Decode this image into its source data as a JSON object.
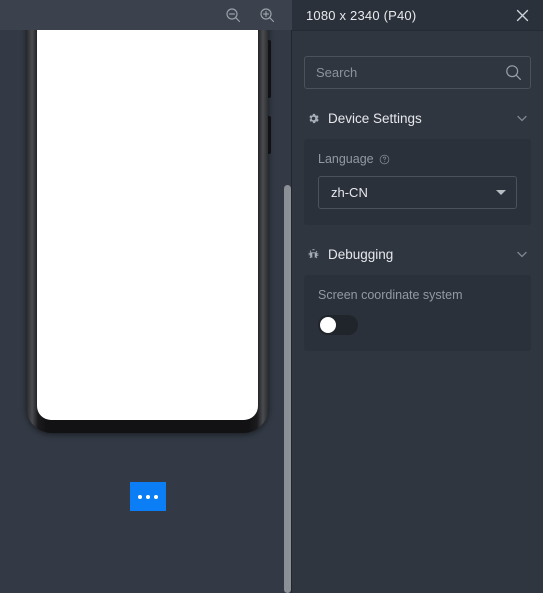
{
  "device_pane": {
    "toolbar": {
      "zoom_out_icon": "zoom-out-icon",
      "zoom_in_icon": "zoom-in-icon"
    },
    "phone": {
      "screen_content": "",
      "side_buttons": [
        "volume",
        "power"
      ]
    },
    "more_button": {
      "icon": "ellipsis-icon",
      "accent_color": "#0b7df5"
    }
  },
  "settings": {
    "header": {
      "title": "1080 x 2340 (P40)",
      "close_icon": "close-icon"
    },
    "search": {
      "placeholder": "Search",
      "value": "",
      "icon": "search-icon"
    },
    "sections": [
      {
        "id": "device-settings",
        "title": "Device Settings",
        "icon": "gear-icon",
        "chevron": "chevron-down-icon",
        "expanded": true,
        "fields": [
          {
            "type": "select",
            "label": "Language",
            "help_icon": "help-circle-icon",
            "value": "zh-CN",
            "caret": "caret-down-icon"
          }
        ]
      },
      {
        "id": "debugging",
        "title": "Debugging",
        "icon": "bug-icon",
        "chevron": "chevron-down-icon",
        "expanded": true,
        "fields": [
          {
            "type": "toggle",
            "label": "Screen coordinate system",
            "value": "off"
          }
        ]
      }
    ]
  },
  "colors": {
    "pane_bg": "#333a45",
    "panel_bg": "#2f3640",
    "card_bg": "#2b313a",
    "accent": "#0b7df5",
    "text_primary": "#e6e8ec",
    "text_muted": "#9399a2",
    "border": "#4b525c"
  }
}
